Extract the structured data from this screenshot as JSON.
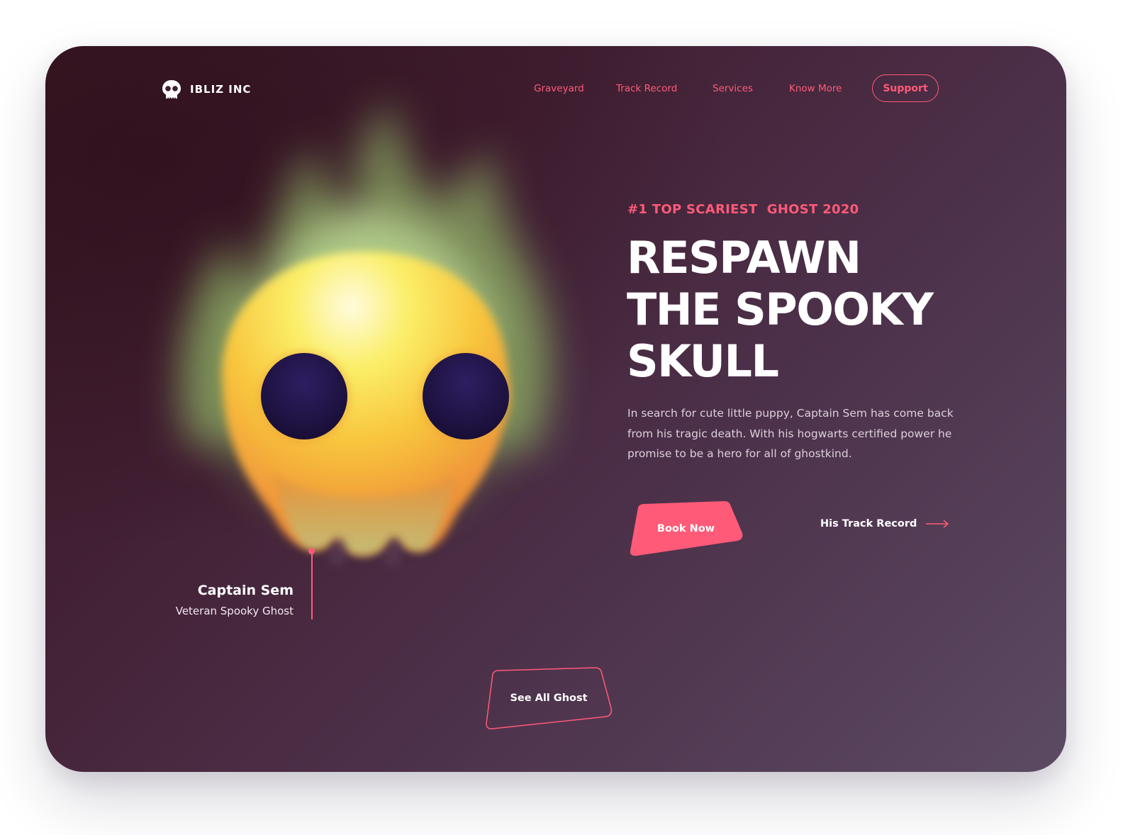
{
  "brand": {
    "name": "IBLIZ INC",
    "logo_icon": "skull-icon"
  },
  "nav": {
    "links": [
      {
        "label": "Graveyard"
      },
      {
        "label": "Track Record"
      },
      {
        "label": "Services"
      },
      {
        "label": "Know More"
      }
    ],
    "support_label": "Support"
  },
  "hero": {
    "illustration_icon": "skull-icon",
    "eyebrow": "#1 TOP SCARIEST  GHOST 2020",
    "headline_lines": [
      "RESPAWN",
      "THE SPOOKY",
      "SKULL"
    ],
    "description": "In search for cute little puppy, Captain Sem has come back from his tragic death. With his hogwarts certified power he promise to be a hero for all of ghostkind.",
    "primary_cta": "Book Now",
    "secondary_cta": "His Track Record",
    "secondary_cta_icon": "arrow-right-icon"
  },
  "character": {
    "name": "Captain Sem",
    "role": "Veteran Spooky Ghost"
  },
  "footer_cta": {
    "label": "See All Ghost"
  },
  "colors": {
    "accent": "#ff5a78",
    "background_dark": "#3a1a26",
    "background_light": "#5c4a63",
    "text_primary": "#ffffff",
    "skull_yellow": "#f7e24a",
    "skull_orange": "#ef8a34",
    "flame_green": "#a7c878",
    "eye_navy": "#1d1440"
  }
}
